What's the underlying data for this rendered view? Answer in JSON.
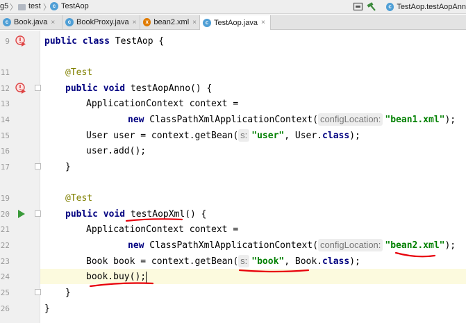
{
  "breadcrumb": {
    "module_partial": "g5",
    "folder": "test",
    "file": "TestAop"
  },
  "run_config": {
    "label": "TestAop.testAopAnn"
  },
  "tabs": [
    {
      "label": "Book.java",
      "active": false
    },
    {
      "label": "BookProxy.java",
      "active": false
    },
    {
      "label": "bean2.xml",
      "active": false
    },
    {
      "label": "TestAop.java",
      "active": true
    }
  ],
  "line_numbers": [
    "9",
    "11",
    "12",
    "13",
    "14",
    "15",
    "16",
    "17",
    "19",
    "20",
    "21",
    "22",
    "23",
    "24",
    "25",
    "26"
  ],
  "code": {
    "l9": {
      "kw1": "public",
      "kw2": "class",
      "rest": " TestAop {"
    },
    "l11": {
      "anno": "@Test"
    },
    "l12": {
      "kw1": "public",
      "kw2": "void",
      "rest": " testAopAnno() {"
    },
    "l13": {
      "text": "ApplicationContext context ="
    },
    "l14": {
      "kw": "new",
      "text": " ClassPathXmlApplicationContext(",
      "hint": "configLocation:",
      "str": "\"bean1.xml\"",
      "end": ");"
    },
    "l15": {
      "text": "User user = context.getBean(",
      "hint": "s:",
      "str": "\"user\"",
      "mid": ", User.",
      "kw": "class",
      "end": ");"
    },
    "l16": {
      "text": "user.add();"
    },
    "l17": {
      "text": "}"
    },
    "l19": {
      "anno": "@Test"
    },
    "l20": {
      "kw1": "public",
      "kw2": "void",
      "rest": " testAopXml() {"
    },
    "l21": {
      "text": "ApplicationContext context ="
    },
    "l22": {
      "kw": "new",
      "text": " ClassPathXmlApplicationContext(",
      "hint": "configLocation:",
      "str": "\"bean2.xml\"",
      "end": ");"
    },
    "l23": {
      "text": "Book book = context.getBean(",
      "hint": "s:",
      "str": "\"book\"",
      "mid": ", Book.",
      "kw": "class",
      "end": ");"
    },
    "l24": {
      "text": "book.buy();"
    },
    "l25": {
      "text": "}"
    },
    "l26": {
      "text": "}"
    }
  },
  "colors": {
    "keyword": "#000080",
    "string": "#008000",
    "annotation": "#808000",
    "annotation_marks": "#e8000b",
    "current_line": "#fcfade"
  }
}
